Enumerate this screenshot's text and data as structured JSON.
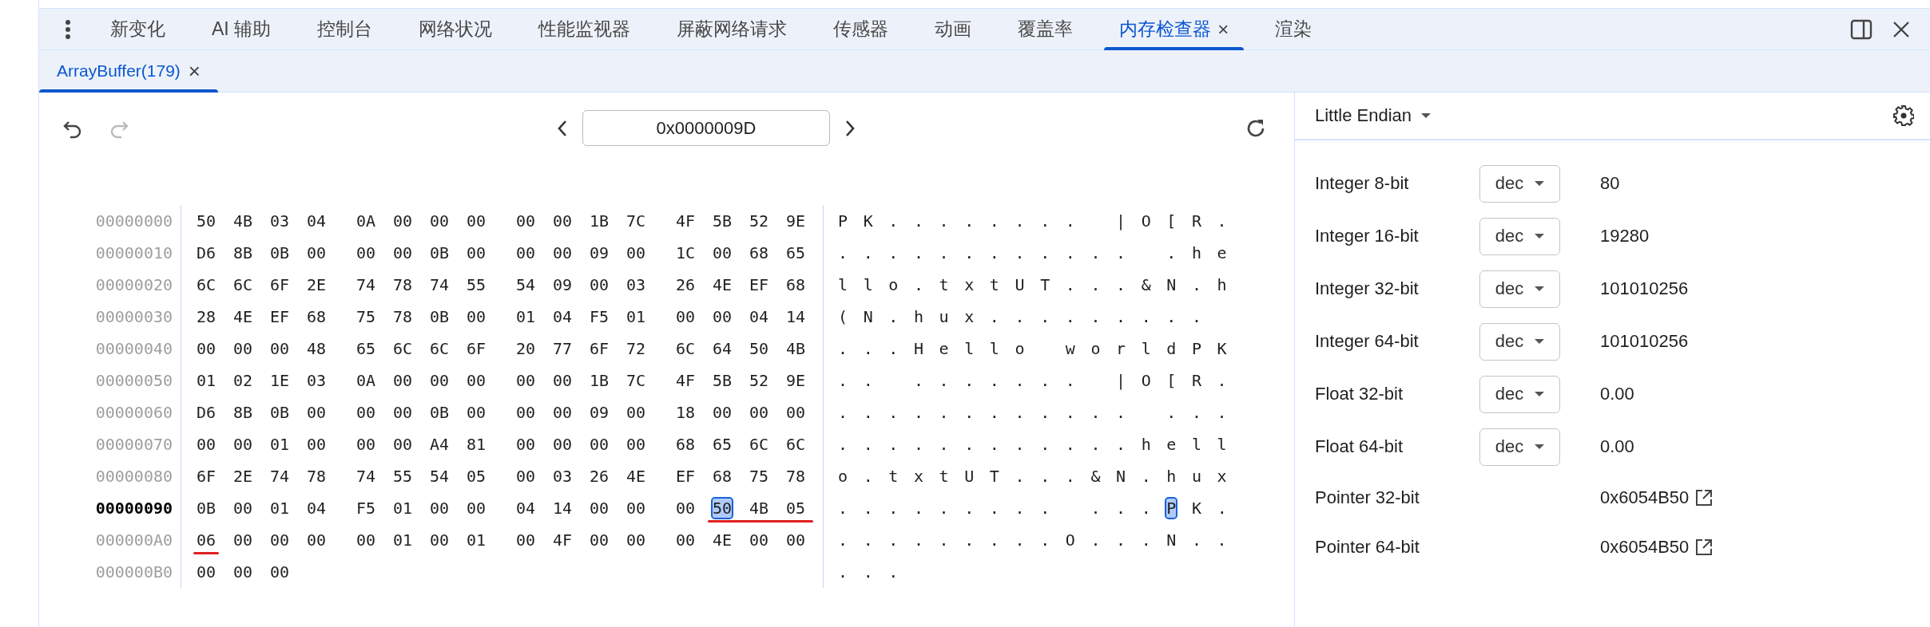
{
  "tabs": [
    {
      "label": "新变化",
      "selected": false,
      "closable": false
    },
    {
      "label": "AI 辅助",
      "selected": false,
      "closable": false
    },
    {
      "label": "控制台",
      "selected": false,
      "closable": false
    },
    {
      "label": "网络状况",
      "selected": false,
      "closable": false
    },
    {
      "label": "性能监视器",
      "selected": false,
      "closable": false
    },
    {
      "label": "屏蔽网络请求",
      "selected": false,
      "closable": false
    },
    {
      "label": "传感器",
      "selected": false,
      "closable": false
    },
    {
      "label": "动画",
      "selected": false,
      "closable": false
    },
    {
      "label": "覆盖率",
      "selected": false,
      "closable": false
    },
    {
      "label": "内存检查器",
      "selected": true,
      "closable": true
    },
    {
      "label": "渲染",
      "selected": false,
      "closable": false
    }
  ],
  "close_tab_glyph": "×",
  "buffer_tabs": [
    {
      "label": "ArrayBuffer(179)",
      "selected": true,
      "close_glyph": "×"
    }
  ],
  "toolbar": {
    "undo_disabled": false,
    "redo_disabled": true,
    "address": "0x0000009D"
  },
  "hex": {
    "rows": [
      {
        "address": "00000000",
        "current": false,
        "underlined": false,
        "bytes": [
          "50",
          "4B",
          "03",
          "04",
          "0A",
          "00",
          "00",
          "00",
          "00",
          "00",
          "1B",
          "7C",
          "4F",
          "5B",
          "52",
          "9E"
        ],
        "ascii": "PK........ |O[R."
      },
      {
        "address": "00000010",
        "current": false,
        "underlined": false,
        "bytes": [
          "D6",
          "8B",
          "0B",
          "00",
          "00",
          "00",
          "0B",
          "00",
          "00",
          "00",
          "09",
          "00",
          "1C",
          "00",
          "68",
          "65"
        ],
        "ascii": "............ .he"
      },
      {
        "address": "00000020",
        "current": false,
        "underlined": false,
        "bytes": [
          "6C",
          "6C",
          "6F",
          "2E",
          "74",
          "78",
          "74",
          "55",
          "54",
          "09",
          "00",
          "03",
          "26",
          "4E",
          "EF",
          "68"
        ],
        "ascii": "llo.txtUT...&N.h"
      },
      {
        "address": "00000030",
        "current": false,
        "underlined": false,
        "bytes": [
          "28",
          "4E",
          "EF",
          "68",
          "75",
          "78",
          "0B",
          "00",
          "01",
          "04",
          "F5",
          "01",
          "00",
          "00",
          "04",
          "14"
        ],
        "ascii": "(N.hux........."
      },
      {
        "address": "00000040",
        "current": false,
        "underlined": false,
        "bytes": [
          "00",
          "00",
          "00",
          "48",
          "65",
          "6C",
          "6C",
          "6F",
          "20",
          "77",
          "6F",
          "72",
          "6C",
          "64",
          "50",
          "4B"
        ],
        "ascii": "...Hello worldPK"
      },
      {
        "address": "00000050",
        "current": false,
        "underlined": false,
        "bytes": [
          "01",
          "02",
          "1E",
          "03",
          "0A",
          "00",
          "00",
          "00",
          "00",
          "00",
          "1B",
          "7C",
          "4F",
          "5B",
          "52",
          "9E"
        ],
        "ascii": ".. ....... |O[R."
      },
      {
        "address": "00000060",
        "current": false,
        "underlined": false,
        "bytes": [
          "D6",
          "8B",
          "0B",
          "00",
          "00",
          "00",
          "0B",
          "00",
          "00",
          "00",
          "09",
          "00",
          "18",
          "00",
          "00",
          "00"
        ],
        "ascii": "............ ..."
      },
      {
        "address": "00000070",
        "current": false,
        "underlined": false,
        "bytes": [
          "00",
          "00",
          "01",
          "00",
          "00",
          "00",
          "A4",
          "81",
          "00",
          "00",
          "00",
          "00",
          "68",
          "65",
          "6C",
          "6C"
        ],
        "ascii": "............hell"
      },
      {
        "address": "00000080",
        "current": false,
        "underlined": false,
        "bytes": [
          "6F",
          "2E",
          "74",
          "78",
          "74",
          "55",
          "54",
          "05",
          "00",
          "03",
          "26",
          "4E",
          "EF",
          "68",
          "75",
          "78"
        ],
        "ascii": "o.txtUT...&N.hux"
      },
      {
        "address": "00000090",
        "current": true,
        "underlined": true,
        "bytes": [
          "0B",
          "00",
          "01",
          "04",
          "F5",
          "01",
          "00",
          "00",
          "04",
          "14",
          "00",
          "00",
          "00"
        ],
        "selected_byte": "50",
        "bytes_after": [
          "4B",
          "05"
        ],
        "ascii": "......... ...",
        "selected_char": "P",
        "ascii_after": "K."
      },
      {
        "address": "000000A0",
        "current": false,
        "underlined": true,
        "bytes": [
          "06",
          "00",
          "00",
          "00",
          "00",
          "01",
          "00",
          "01",
          "00",
          "4F",
          "00",
          "00",
          "00",
          "4E",
          "00",
          "00"
        ],
        "ascii": ".........O...N.."
      },
      {
        "address": "000000B0",
        "current": false,
        "underlined": false,
        "bytes": [
          "00",
          "00",
          "00"
        ],
        "ascii": "..."
      }
    ]
  },
  "inspector": {
    "endianness": "Little Endian",
    "rows": [
      {
        "label": "Integer 8-bit",
        "format": "dec",
        "value": "80",
        "kind": "number"
      },
      {
        "label": "Integer 16-bit",
        "format": "dec",
        "value": "19280",
        "kind": "number"
      },
      {
        "label": "Integer 32-bit",
        "format": "dec",
        "value": "101010256",
        "kind": "number"
      },
      {
        "label": "Integer 64-bit",
        "format": "dec",
        "value": "101010256",
        "kind": "number"
      },
      {
        "label": "Float 32-bit",
        "format": "dec",
        "value": "0.00",
        "kind": "number"
      },
      {
        "label": "Float 64-bit",
        "format": "dec",
        "value": "0.00",
        "kind": "number"
      },
      {
        "label": "Pointer 32-bit",
        "value": "0x6054B50",
        "kind": "pointer"
      },
      {
        "label": "Pointer 64-bit",
        "value": "0x6054B50",
        "kind": "pointer"
      }
    ]
  }
}
